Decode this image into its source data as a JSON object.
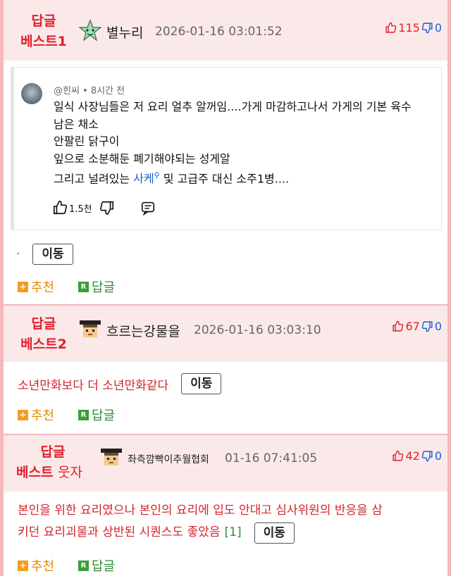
{
  "comments": [
    {
      "best_line1": "답글",
      "best_line2": "베스트1",
      "avatar_icon": "star-character-icon",
      "nickname": "별누리",
      "time": "2026-01-16 03:01:52",
      "likes": "115",
      "dislikes": "0",
      "embed": {
        "handle": "@힌씨 • 8시간 전",
        "lines": [
          "일식 사장님들은 저 요리 얼추 알꺼임....가게 마감하고나서 가게의 기본 육수",
          "남은 채소",
          "안팔린 닭구이",
          "잎으로 소분해둔 폐기해야되는 성게알"
        ],
        "last_line_pre": "그리고 널려있는 ",
        "last_line_link": "사케",
        "last_line_post": " 및 고급주 대신 소주1병....",
        "like_count": "1.5천"
      },
      "content": "·",
      "move_label": "이동",
      "rec_label": "추천",
      "reply_label": "답글"
    },
    {
      "best_line1": "답글",
      "best_line2": "베스트2",
      "avatar_icon": "pixel-character-icon",
      "nickname": "흐르는강물을",
      "time": "2026-01-16 03:03:10",
      "likes": "67",
      "dislikes": "0",
      "content": "소년만화보다 더 소년만화같다",
      "move_label": "이동",
      "rec_label": "추천",
      "reply_label": "답글"
    },
    {
      "best_line1": "답글",
      "best_line2": "베스트",
      "best_suffix": "웃자",
      "avatar_icon": "pixel-character-icon",
      "nickname": "좌측깜빡이추월협회",
      "time": "01-16 07:41:05",
      "likes": "42",
      "dislikes": "0",
      "content_line1": "본인을 위한 요리였으나 본인의 요리에 입도 안대고 심사위원의 반응을 삼",
      "content_line2": "키던 요리괴물과 상반된 시퀀스도 좋았음",
      "content_ref": "[1]",
      "move_label": "이동",
      "rec_label": "추천",
      "reply_label": "답글"
    }
  ]
}
